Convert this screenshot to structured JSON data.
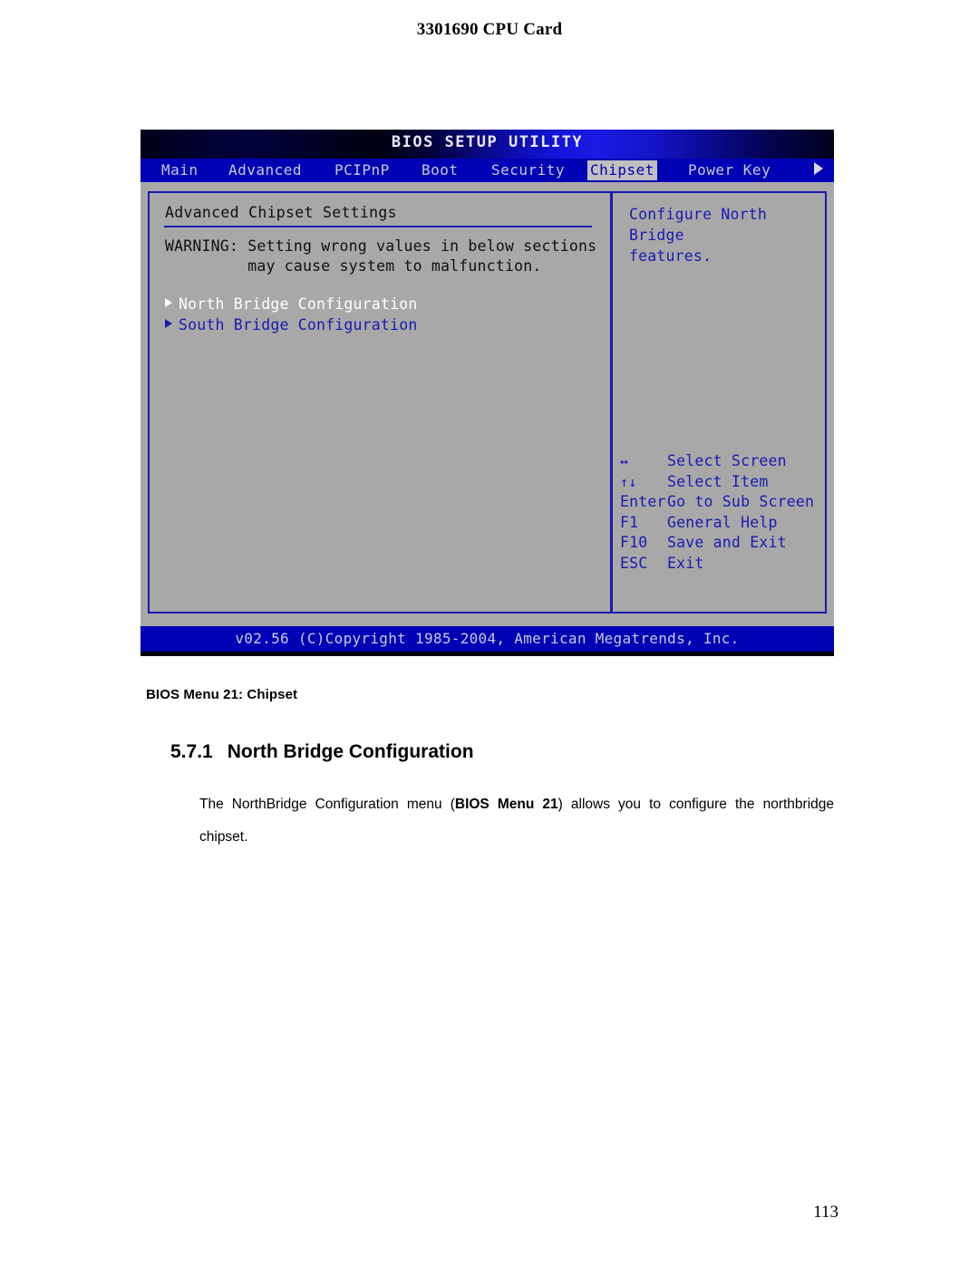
{
  "document": {
    "header_title": "3301690 CPU Card",
    "page_number": "113",
    "caption": "BIOS Menu 21: Chipset",
    "section": {
      "number": "5.7.1",
      "title": "North Bridge Configuration"
    },
    "paragraph": {
      "before": "The NorthBridge Configuration menu (",
      "bold": "BIOS Menu 21",
      "after": ") allows you to configure the northbridge chipset."
    }
  },
  "bios": {
    "title": "BIOS SETUP UTILITY",
    "menu": [
      {
        "label": "Main",
        "selected": false
      },
      {
        "label": "Advanced",
        "selected": false
      },
      {
        "label": "PCIPnP",
        "selected": false
      },
      {
        "label": "Boot",
        "selected": false
      },
      {
        "label": "Security",
        "selected": false
      },
      {
        "label": "Chipset",
        "selected": true
      },
      {
        "label": "Power Key",
        "selected": false
      }
    ],
    "menu_overflow_icon": "right-arrow-icon",
    "left_panel": {
      "section_title": "Advanced Chipset Settings",
      "warning_line1": "WARNING: Setting wrong values in below sections",
      "warning_line2": "         may cause system to malfunction.",
      "items": [
        {
          "label": "North Bridge Configuration",
          "selected": true
        },
        {
          "label": "South Bridge Configuration",
          "selected": false
        }
      ]
    },
    "right_panel": {
      "help_line1": "Configure North Bridge",
      "help_line2": "features.",
      "key_legend": [
        {
          "key": "↔",
          "desc": "Select Screen",
          "icon": "left-right-arrow-icon"
        },
        {
          "key": "↑↓",
          "desc": "Select Item",
          "icon": "up-down-arrow-icon"
        },
        {
          "key": "Enter",
          "desc": "Go to Sub Screen",
          "icon": ""
        },
        {
          "key": "F1",
          "desc": "General Help",
          "icon": ""
        },
        {
          "key": "F10",
          "desc": "Save and Exit",
          "icon": ""
        },
        {
          "key": "ESC",
          "desc": "Exit",
          "icon": ""
        }
      ]
    },
    "footer": "v02.56 (C)Copyright 1985-2004, American Megatrends, Inc.",
    "colors": {
      "menubar_blue": "#0000b4",
      "body_gray": "#a8a8a8",
      "border_blue": "#1a1ab0",
      "selected_text": "#ffffff",
      "link_blue": "#1a1ab0"
    }
  }
}
